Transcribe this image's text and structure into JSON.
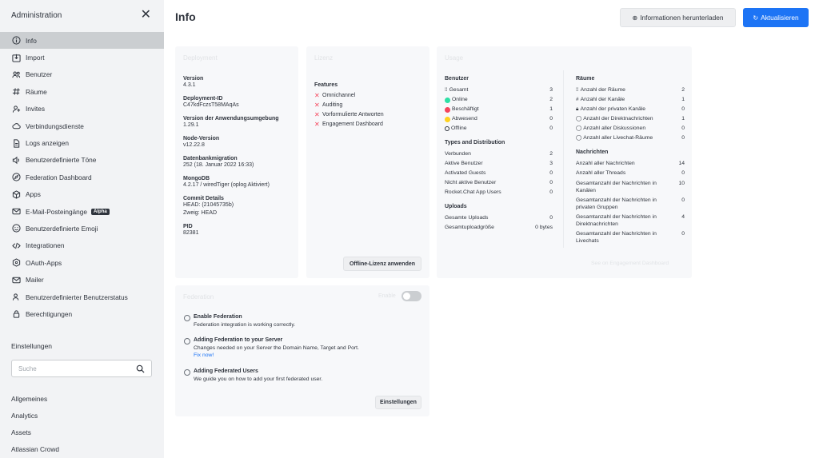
{
  "sidebar": {
    "title": "Administration",
    "items": [
      {
        "label": "Info",
        "icon": "info-icon"
      },
      {
        "label": "Import",
        "icon": "import-icon"
      },
      {
        "label": "Benutzer",
        "icon": "users-icon"
      },
      {
        "label": "Räume",
        "icon": "hashtag-icon"
      },
      {
        "label": "Invites",
        "icon": "user-plus-icon"
      },
      {
        "label": "Verbindungsdienste",
        "icon": "cloud-icon"
      },
      {
        "label": "Logs anzeigen",
        "icon": "document-icon"
      },
      {
        "label": "Benutzerdefinierte Töne",
        "icon": "speaker-icon"
      },
      {
        "label": "Federation Dashboard",
        "icon": "discover-icon"
      },
      {
        "label": "Apps",
        "icon": "cube-icon"
      },
      {
        "label": "E-Mail-Posteingänge",
        "icon": "mail-icon",
        "badge": "Alpha"
      },
      {
        "label": "Benutzerdefinierte Emoji",
        "icon": "emoji-icon"
      },
      {
        "label": "Integrationen",
        "icon": "code-icon"
      },
      {
        "label": "OAuth-Apps",
        "icon": "oauth-icon"
      },
      {
        "label": "Mailer",
        "icon": "mail-icon"
      },
      {
        "label": "Benutzerdefinierter Benutzerstatus",
        "icon": "user-status-icon"
      },
      {
        "label": "Berechtigungen",
        "icon": "lock-icon"
      }
    ],
    "settings_label": "Einstellungen",
    "search_placeholder": "Suche",
    "settings_items": [
      "Allgemeines",
      "Analytics",
      "Assets",
      "Atlassian Crowd"
    ]
  },
  "header": {
    "title": "Info",
    "download_label": "Informationen herunterladen",
    "refresh_label": "Aktualisieren"
  },
  "deployment": {
    "title": "Deployment",
    "version_label": "Version",
    "version": "4.3.1",
    "id_label": "Deployment-ID",
    "id": "C47kdFczsT58MAqAs",
    "app_version_label": "Version der Anwendungsumgebung",
    "app_version": "1.29.1",
    "node_label": "Node-Version",
    "node": "v12.22.8",
    "migration_label": "Datenbankmigration",
    "migration": "252 (18. Januar 2022 16:33)",
    "mongo_label": "MongoDB",
    "mongo": "4.2.17 / wiredTiger (oplog Aktiviert)",
    "commit_label": "Commit Details",
    "commit_head": "HEAD: (21045735b)",
    "commit_branch": "Zweig: HEAD",
    "pid_label": "PID",
    "pid": "82381"
  },
  "license": {
    "title": "Lizenz",
    "features_label": "Features",
    "features": [
      "Omnichannel",
      "Auditing",
      "Vorformulierte Antworten",
      "Engagement Dashboard"
    ],
    "offline_button": "Offline-Lizenz anwenden"
  },
  "usage": {
    "title": "Usage",
    "users": {
      "heading": "Benutzer",
      "rows": [
        {
          "label": "Gesamt",
          "value": "3"
        },
        {
          "label": "Online",
          "value": "2",
          "color": "#2de0a5"
        },
        {
          "label": "Beschäftigt",
          "value": "1",
          "color": "#f5455c"
        },
        {
          "label": "Abwesend",
          "value": "0",
          "color": "#ffd21f"
        },
        {
          "label": "Offline",
          "value": "0"
        }
      ]
    },
    "types": {
      "heading": "Types and Distribution",
      "rows": [
        {
          "label": "Verbunden",
          "value": "2"
        },
        {
          "label": "Aktive Benutzer",
          "value": "3"
        },
        {
          "label": "Activated Guests",
          "value": "0"
        },
        {
          "label": "Nicht aktive Benutzer",
          "value": "0"
        },
        {
          "label": "Rocket.Chat App Users",
          "value": "0"
        }
      ]
    },
    "uploads": {
      "heading": "Uploads",
      "rows": [
        {
          "label": "Gesamte Uploads",
          "value": "0"
        },
        {
          "label": "Gesamtuploadgröße",
          "value": "0 bytes"
        }
      ]
    },
    "rooms": {
      "heading": "Räume",
      "rows": [
        {
          "label": "Anzahl der Räume",
          "value": "2"
        },
        {
          "label": "Anzahl der Kanäle",
          "value": "1"
        },
        {
          "label": "Anzahl der privaten Kanäle",
          "value": "0"
        },
        {
          "label": "Anzahl der Direktnachrichten",
          "value": "1"
        },
        {
          "label": "Anzahl aller Diskussionen",
          "value": "0"
        },
        {
          "label": "Anzahl aller Livechat-Räume",
          "value": "0"
        }
      ]
    },
    "messages": {
      "heading": "Nachrichten",
      "rows": [
        {
          "label": "Anzahl aller Nachrichten",
          "value": "14"
        },
        {
          "label": "Anzahl aller Threads",
          "value": "0"
        },
        {
          "label": "Gesamtanzahl der Nachrichten in Kanälen",
          "value": "10"
        },
        {
          "label": "Gesamtanzahl der Nachrichten in privaten Gruppen",
          "value": "0"
        },
        {
          "label": "Gesamtanzahl der Nachrichten in Direktnachrichten",
          "value": "4"
        },
        {
          "label": "Gesamtanzahl der Nachrichten in Livechats",
          "value": "0"
        }
      ]
    },
    "engagement_link": "See on Engagement Dashboard"
  },
  "federation": {
    "title": "Federation",
    "toggle_label": "Enable",
    "steps": [
      {
        "title": "Enable Federation",
        "desc": "Federation integration is working correctly."
      },
      {
        "title": "Adding Federation to your Server",
        "desc": "Changes needed on your Server the Domain Name, Target and Port.",
        "link": "Fix now!"
      },
      {
        "title": "Adding Federated Users",
        "desc": "We guide you on how to add your first federated user."
      }
    ],
    "settings_button": "Einstellungen"
  },
  "colors": {
    "accent": "#1d74f5",
    "sidebar_bg": "#f2f3f5",
    "active_item": "#cbced1",
    "error": "#f5455c"
  }
}
